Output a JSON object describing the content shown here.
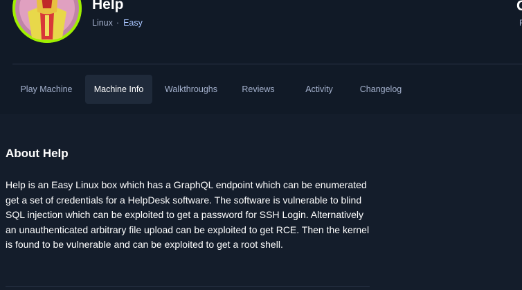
{
  "machine": {
    "name": "Help",
    "os": "Linux",
    "separator": "·",
    "difficulty": "Easy",
    "edge_partial_text": "C",
    "edge_partial_small": "R"
  },
  "tabs": [
    {
      "label": "Play Machine",
      "active": false
    },
    {
      "label": "Machine Info",
      "active": true
    },
    {
      "label": "Walkthroughs",
      "active": false
    },
    {
      "label": "Reviews",
      "active": false
    },
    {
      "label": "Activity",
      "active": false
    },
    {
      "label": "Changelog",
      "active": false
    }
  ],
  "about": {
    "heading": "About Help",
    "text": "Help is an Easy Linux box which has a GraphQL endpoint which can be enumerated get a set of credentials for a HelpDesk software. The software is vulnerable to blind SQL injection which can be exploited to get a password for SSH Login. Alternatively an unauthenticated arbitrary file upload can be exploited to get RCE. Then the kernel is found to be vulnerable and can be exploited to get a root shell."
  },
  "colors": {
    "background": "#141d2b",
    "header": "#111a27",
    "accent_green": "#9fef00",
    "difficulty_blue": "#a8c5ff",
    "muted_text": "#a4b1cd"
  }
}
